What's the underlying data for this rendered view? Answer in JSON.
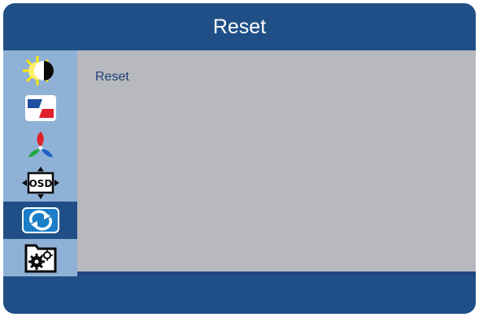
{
  "window": {
    "title": "Reset"
  },
  "sidebar": {
    "items": [
      {
        "icon": "brightness-contrast-icon",
        "selected": false
      },
      {
        "icon": "image-setup-icon",
        "selected": false
      },
      {
        "icon": "color-rgb-icon",
        "selected": false
      },
      {
        "icon": "osd-setup-icon",
        "selected": false
      },
      {
        "icon": "reset-icon",
        "selected": true
      },
      {
        "icon": "extra-settings-icon",
        "selected": false
      }
    ]
  },
  "content": {
    "label": "Reset"
  },
  "colors": {
    "panel": "#1f4f86",
    "sidebar": "#8fb1d6",
    "content": "#b7b9be",
    "text": "#1f3f78"
  }
}
